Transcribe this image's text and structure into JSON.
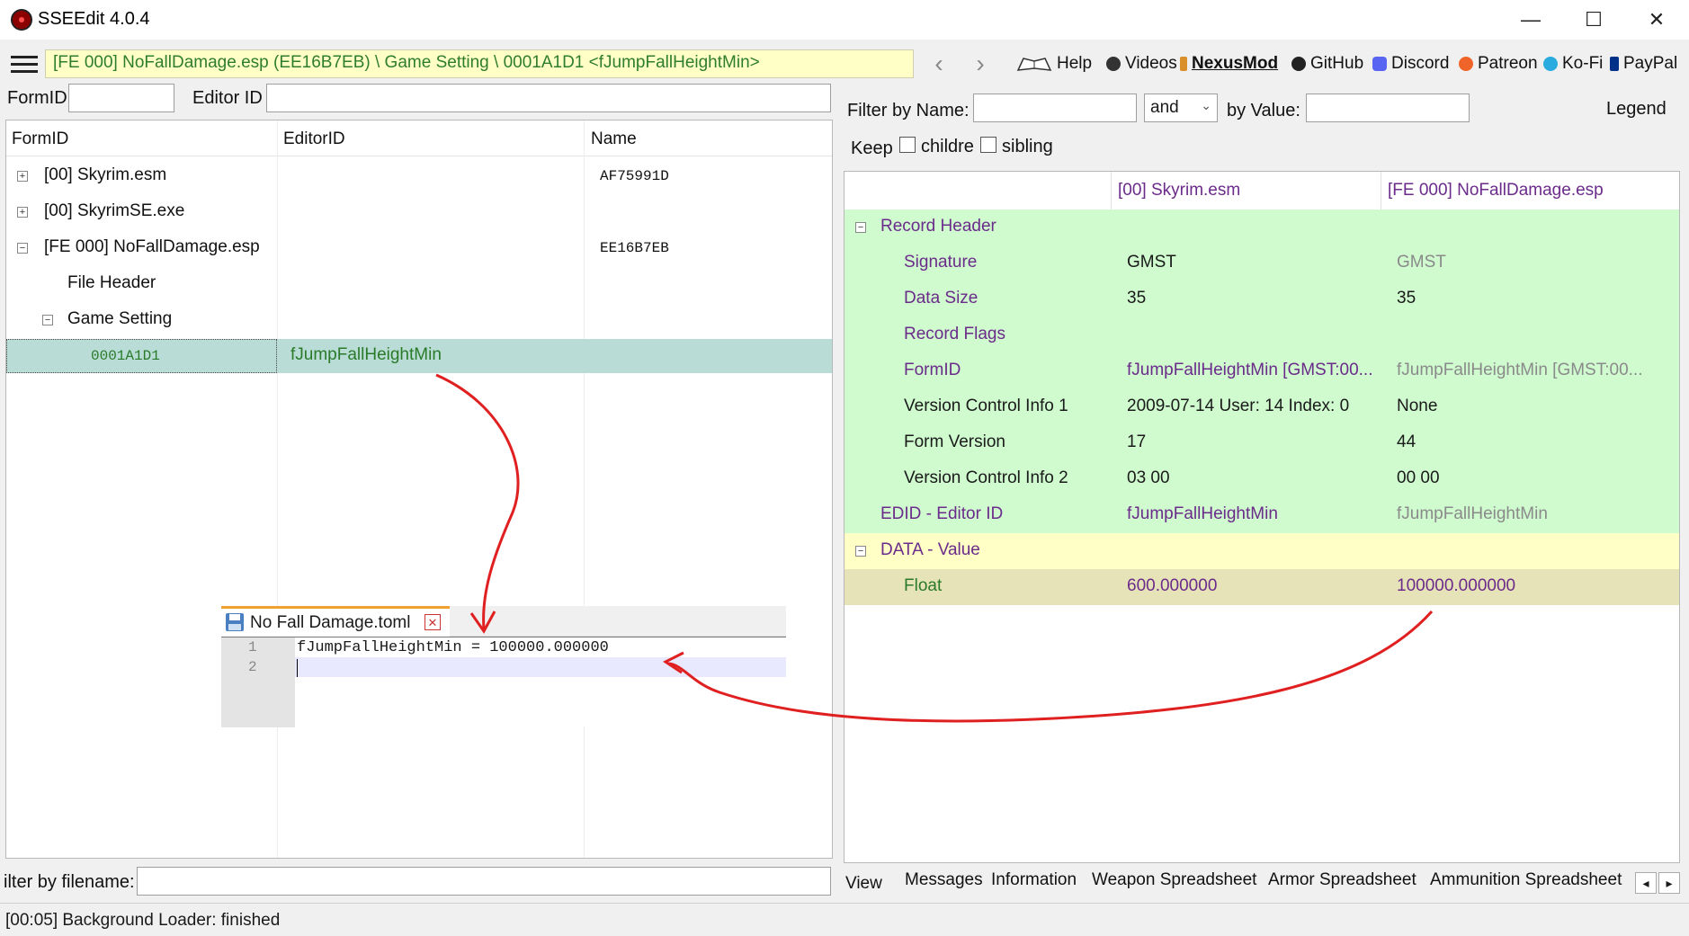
{
  "window": {
    "title": "SSEEdit 4.0.4",
    "minimize": "—",
    "maximize": "☐",
    "close": "✕"
  },
  "toolbar": {
    "path": "[FE 000] NoFallDamage.esp (EE16B7EB) \\ Game Setting \\ 0001A1D1 <fJumpFallHeightMin>",
    "back": "‹",
    "forward": "›",
    "links": {
      "help": "Help",
      "videos": "Videos",
      "nexusmod": "NexusMod",
      "github": "GitHub",
      "discord": "Discord",
      "patreon": "Patreon",
      "kofi": "Ko-Fi",
      "paypal": "PayPal"
    }
  },
  "left": {
    "formid_label": "FormID",
    "editorid_label": "Editor ID",
    "formid_value": "",
    "editorid_value": "",
    "headers": {
      "formid": "FormID",
      "editorid": "EditorID",
      "name": "Name"
    },
    "rows": [
      {
        "label": "[00] Skyrim.esm",
        "name": "AF75991D",
        "expander": "+"
      },
      {
        "label": "[00] SkyrimSE.exe",
        "name": "",
        "expander": "+"
      },
      {
        "label": "[FE 000] NoFallDamage.esp",
        "name": "EE16B7EB",
        "expander": "−"
      },
      {
        "label": "File Header",
        "name": "",
        "expander": ""
      },
      {
        "label": "Game Setting",
        "name": "",
        "expander": "−"
      },
      {
        "label": "0001A1D1",
        "editorid": "fJumpFallHeightMin",
        "name": "",
        "selected": true
      }
    ],
    "filter_filename_label": "ilter by filename:",
    "filter_filename_value": ""
  },
  "right": {
    "filter_name_label": "Filter by Name:",
    "filter_name_value": "",
    "and_select": "and",
    "filter_value_label": "by Value:",
    "filter_value_value": "",
    "legend": "Legend",
    "keep_label": "Keep",
    "children_label": "childre",
    "siblings_label": "sibling",
    "col_headers": [
      "[00] Skyrim.esm",
      "[FE 000] NoFallDamage.esp"
    ],
    "rows": [
      {
        "label": "Record Header",
        "v1": "",
        "v2": "",
        "expander": "−",
        "indent": 0
      },
      {
        "label": "Signature",
        "v1": "GMST",
        "v2": "GMST",
        "indent": 1
      },
      {
        "label": "Data Size",
        "v1": "35",
        "v2": "35",
        "indent": 1
      },
      {
        "label": "Record Flags",
        "v1": "",
        "v2": "",
        "indent": 1
      },
      {
        "label": "FormID",
        "v1": "fJumpFallHeightMin [GMST:00...",
        "v2": "fJumpFallHeightMin [GMST:00...",
        "indent": 1
      },
      {
        "label": "Version Control Info 1",
        "v1": "2009-07-14 User: 14 Index: 0",
        "v2": "None",
        "indent": 1
      },
      {
        "label": "Form Version",
        "v1": "17",
        "v2": "44",
        "indent": 1
      },
      {
        "label": "Version Control Info 2",
        "v1": "03 00",
        "v2": "00 00",
        "indent": 1
      },
      {
        "label": "EDID - Editor ID",
        "v1": "fJumpFallHeightMin",
        "v2": "fJumpFallHeightMin",
        "indent": 0
      },
      {
        "label": "DATA - Value",
        "v1": "",
        "v2": "",
        "expander": "−",
        "indent": 0
      },
      {
        "label": "Float",
        "v1": "600.000000",
        "v2": "100000.000000",
        "indent": 1
      }
    ],
    "tabs": [
      "View",
      "Messages",
      "Information",
      "Weapon Spreadsheet",
      "Armor Spreadsheet",
      "Ammunition Spreadsheet"
    ],
    "tab_scroll_left": "◂",
    "tab_scroll_right": "▸"
  },
  "editor": {
    "tab_title": "No Fall Damage.toml",
    "tab_close": "✕",
    "line_numbers": [
      "1",
      "2"
    ],
    "line1": "fJumpFallHeightMin = 100000.000000"
  },
  "status": {
    "text": "[00:05] Background Loader: finished"
  },
  "colors": {
    "path_bg": "#ffffc6",
    "selected_row": "#b9ddd6",
    "green_rows": "#cffbcf",
    "yellow_row": "#ffffc6",
    "tan_row": "#e6e3b8",
    "annotation_red": "#e02020"
  }
}
